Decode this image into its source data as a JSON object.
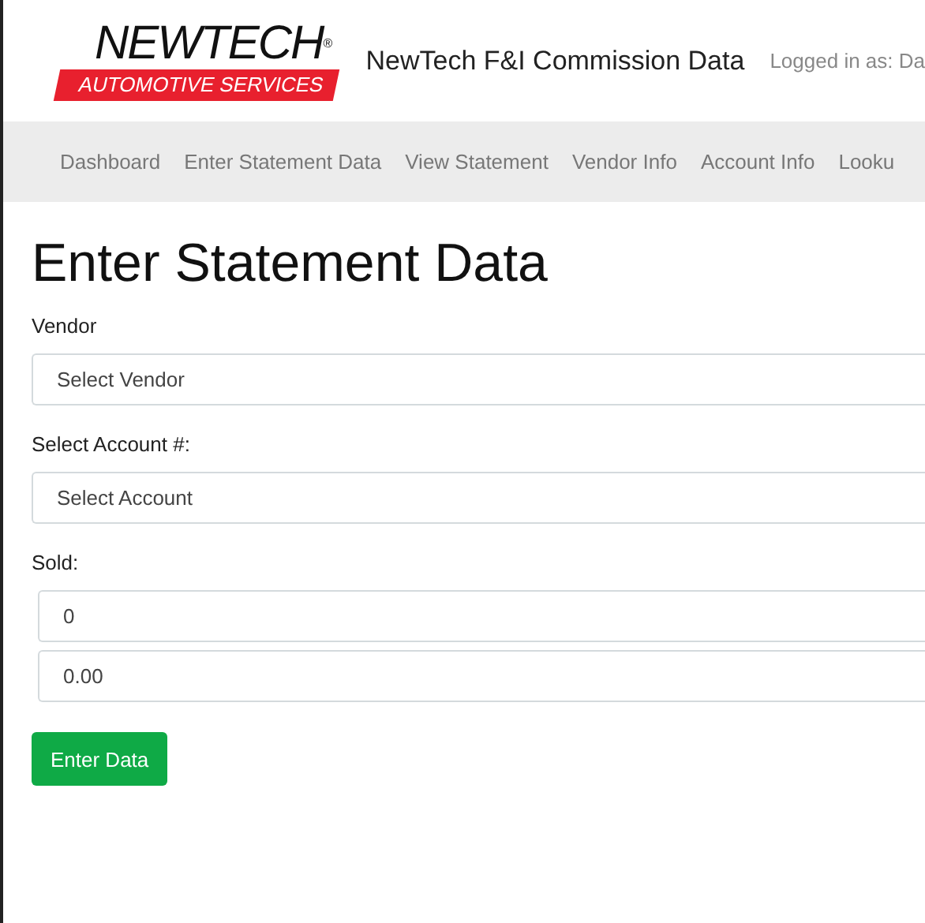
{
  "logo": {
    "name": "NEWTECH",
    "mark": "®",
    "tagline": "AUTOMOTIVE SERVICES"
  },
  "site_title": "NewTech F&I Commission Data",
  "user": "Logged in as: Da",
  "nav": [
    {
      "label": "Dashboard"
    },
    {
      "label": "Enter Statement Data"
    },
    {
      "label": "View Statement"
    },
    {
      "label": "Vendor Info"
    },
    {
      "label": "Account Info"
    },
    {
      "label": "Looku"
    }
  ],
  "heading": "Enter Statement Data",
  "form": [
    {
      "kind": "select",
      "label": "Vendor",
      "value": "Select Vendor"
    },
    {
      "kind": "select",
      "label": "Select Account #:",
      "value": "Select Account"
    },
    {
      "kind": "group",
      "label": "Sold:",
      "inputs": [
        "0",
        "0.00"
      ]
    }
  ],
  "submit": "Enter Data"
}
